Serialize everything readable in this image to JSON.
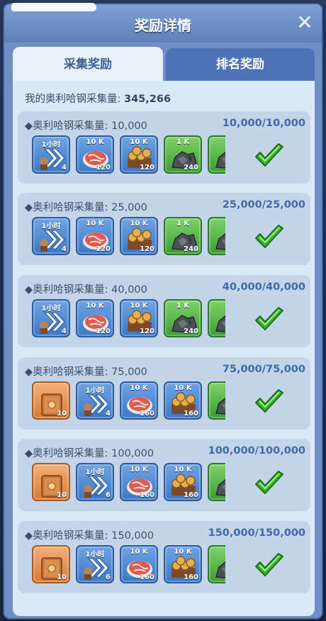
{
  "window": {
    "title": "奖励详情",
    "close_label": "✕"
  },
  "tabs": [
    {
      "label": "采集奖励",
      "active": true
    },
    {
      "label": "排名奖励",
      "active": false
    }
  ],
  "total": {
    "label": "我的奥利哈钢采集量:",
    "value": "345,266"
  },
  "colors": {
    "blue_item": "#3c78c6",
    "green_item": "#3c9d33",
    "orange_item": "#d97a35",
    "check": "#3fb32d"
  },
  "tiers": [
    {
      "label": "◆奥利哈钢采集量: 10,000",
      "progress": "10,000/10,000",
      "items": [
        {
          "kind": "speedup",
          "top": "1小时",
          "qty": "4",
          "color": "blue",
          "icon": "speedup-icon"
        },
        {
          "kind": "meat",
          "top": "10 K",
          "qty": "120",
          "color": "blue",
          "icon": "meat-icon"
        },
        {
          "kind": "wood",
          "top": "10 K",
          "qty": "120",
          "color": "blue",
          "icon": "wood-icon"
        },
        {
          "kind": "ore",
          "top": "1 K",
          "qty": "240",
          "color": "green",
          "icon": "ore-icon"
        },
        {
          "kind": "ore",
          "top": "",
          "qty": "",
          "color": "green",
          "icon": "ore-icon"
        }
      ]
    },
    {
      "label": "◆奥利哈钢采集量: 25,000",
      "progress": "25,000/25,000",
      "items": [
        {
          "kind": "speedup",
          "top": "1小时",
          "qty": "4",
          "color": "blue",
          "icon": "speedup-icon"
        },
        {
          "kind": "meat",
          "top": "10 K",
          "qty": "120",
          "color": "blue",
          "icon": "meat-icon"
        },
        {
          "kind": "wood",
          "top": "10 K",
          "qty": "120",
          "color": "blue",
          "icon": "wood-icon"
        },
        {
          "kind": "ore",
          "top": "1 K",
          "qty": "240",
          "color": "green",
          "icon": "ore-icon"
        },
        {
          "kind": "ore",
          "top": "",
          "qty": "",
          "color": "green",
          "icon": "ore-icon"
        }
      ]
    },
    {
      "label": "◆奥利哈钢采集量: 40,000",
      "progress": "40,000/40,000",
      "items": [
        {
          "kind": "speedup",
          "top": "1小时",
          "qty": "4",
          "color": "blue",
          "icon": "speedup-icon"
        },
        {
          "kind": "meat",
          "top": "10 K",
          "qty": "120",
          "color": "blue",
          "icon": "meat-icon"
        },
        {
          "kind": "wood",
          "top": "10 K",
          "qty": "120",
          "color": "blue",
          "icon": "wood-icon"
        },
        {
          "kind": "ore",
          "top": "1 K",
          "qty": "240",
          "color": "green",
          "icon": "ore-icon"
        },
        {
          "kind": "ore",
          "top": "",
          "qty": "",
          "color": "green",
          "icon": "ore-icon"
        }
      ]
    },
    {
      "label": "◆奥利哈钢采集量: 75,000",
      "progress": "75,000/75,000",
      "items": [
        {
          "kind": "book",
          "top": "",
          "qty": "10",
          "color": "orange",
          "icon": "book-icon"
        },
        {
          "kind": "speedup",
          "top": "1小时",
          "qty": "4",
          "color": "blue",
          "icon": "speedup-icon"
        },
        {
          "kind": "meat",
          "top": "10 K",
          "qty": "160",
          "color": "blue",
          "icon": "meat-icon"
        },
        {
          "kind": "wood",
          "top": "10 K",
          "qty": "160",
          "color": "blue",
          "icon": "wood-icon"
        },
        {
          "kind": "ore",
          "top": "",
          "qty": "",
          "color": "green",
          "icon": "ore-icon"
        }
      ]
    },
    {
      "label": "◆奥利哈钢采集量: 100,000",
      "progress": "100,000/100,000",
      "items": [
        {
          "kind": "book",
          "top": "",
          "qty": "10",
          "color": "orange",
          "icon": "book-icon"
        },
        {
          "kind": "speedup",
          "top": "1小时",
          "qty": "6",
          "color": "blue",
          "icon": "speedup-icon"
        },
        {
          "kind": "meat",
          "top": "10 K",
          "qty": "160",
          "color": "blue",
          "icon": "meat-icon"
        },
        {
          "kind": "wood",
          "top": "10 K",
          "qty": "160",
          "color": "blue",
          "icon": "wood-icon"
        },
        {
          "kind": "ore",
          "top": "",
          "qty": "",
          "color": "green",
          "icon": "ore-icon"
        }
      ]
    },
    {
      "label": "◆奥利哈钢采集量: 150,000",
      "progress": "150,000/150,000",
      "items": [
        {
          "kind": "book",
          "top": "",
          "qty": "10",
          "color": "orange",
          "icon": "book-icon"
        },
        {
          "kind": "speedup",
          "top": "1小时",
          "qty": "6",
          "color": "blue",
          "icon": "speedup-icon"
        },
        {
          "kind": "meat",
          "top": "10 K",
          "qty": "160",
          "color": "blue",
          "icon": "meat-icon"
        },
        {
          "kind": "wood",
          "top": "10 K",
          "qty": "160",
          "color": "blue",
          "icon": "wood-icon"
        },
        {
          "kind": "ore",
          "top": "",
          "qty": "",
          "color": "green",
          "icon": "ore-icon"
        }
      ]
    }
  ]
}
